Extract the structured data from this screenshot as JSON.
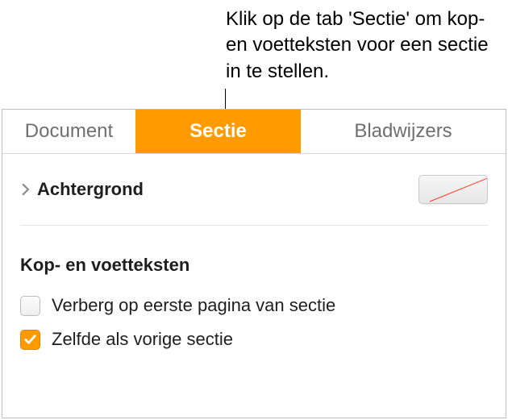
{
  "callout": {
    "text": "Klik op de tab 'Sectie' om kop- en voetteksten voor een sectie in te stellen."
  },
  "tabs": {
    "document": "Document",
    "sectie": "Sectie",
    "bladwijzers": "Bladwijzers",
    "selected": "sectie"
  },
  "section": {
    "background_label": "Achtergrond",
    "headers_footers_heading": "Kop- en voetteksten",
    "hide_first_page_label": "Verberg op eerste pagina van sectie",
    "hide_first_page_checked": false,
    "same_as_previous_label": "Zelfde als vorige sectie",
    "same_as_previous_checked": true
  }
}
